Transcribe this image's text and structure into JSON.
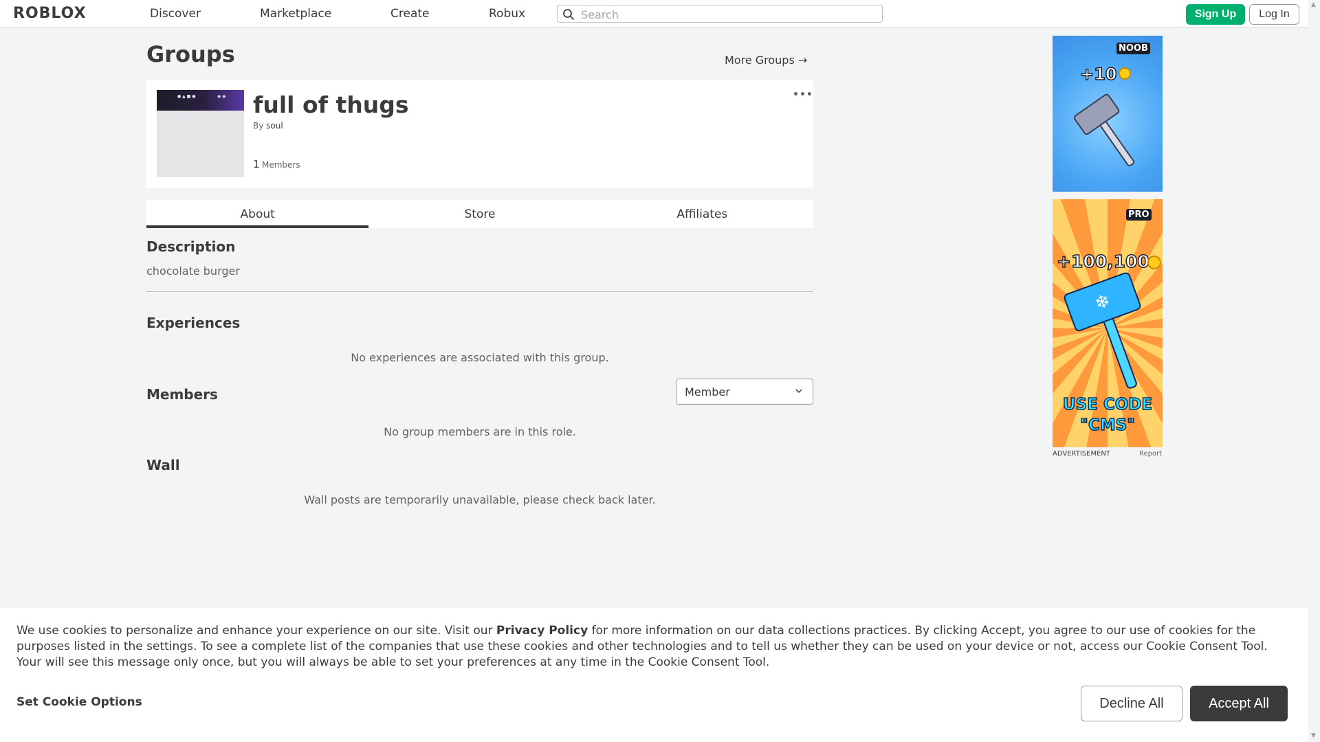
{
  "header": {
    "logo": "ROBLOX",
    "nav": [
      "Discover",
      "Marketplace",
      "Create",
      "Robux"
    ],
    "search_placeholder": "Search",
    "signup_label": "Sign Up",
    "login_label": "Log In"
  },
  "page": {
    "title": "Groups",
    "more_groups": "More Groups →"
  },
  "group": {
    "name": "full of thugs",
    "by_label": "By",
    "owner": "soul",
    "member_count": "1",
    "members_label": "Members",
    "more_icon": "ellipsis-icon"
  },
  "tabs": [
    {
      "label": "About",
      "active": true
    },
    {
      "label": "Store",
      "active": false
    },
    {
      "label": "Affiliates",
      "active": false
    }
  ],
  "about": {
    "description_heading": "Description",
    "description_text": "chocolate burger",
    "experiences_heading": "Experiences",
    "experiences_empty": "No experiences are associated with this group.",
    "members_heading": "Members",
    "role_select_value": "Member",
    "members_empty": "No group members are in this role.",
    "wall_heading": "Wall",
    "wall_empty": "Wall posts are temporarily unavailable, please check back later."
  },
  "ads": {
    "ad1": {
      "tag": "NOOB",
      "amount": "+10"
    },
    "ad2": {
      "tag": "PRO",
      "amount": "+100,100",
      "code_line1": "USE CODE",
      "code_line2": "\"CMS\""
    },
    "advertisement_label": "ADVERTISEMENT",
    "report_label": "Report"
  },
  "cookie": {
    "text_1": "We use cookies to personalize and enhance your experience on our site. Visit our ",
    "privacy_link": "Privacy Policy",
    "text_2": " for more information on our data collections practices. By clicking Accept, you agree to our use of cookies for the purposes listed in the settings. To see a complete list of the companies that use these cookies and other technologies and to tell us whether they can be used on your device or not, access our Cookie Consent Tool. Your will see this message only once, but you will always be able to set your preferences at any time in the Cookie Consent Tool.",
    "options_label": "Set Cookie Options",
    "decline_label": "Decline All",
    "accept_label": "Accept All"
  },
  "colors": {
    "signup_green": "#00b06f",
    "accept_dark": "#393b3d",
    "background": "#f2f4f5"
  }
}
